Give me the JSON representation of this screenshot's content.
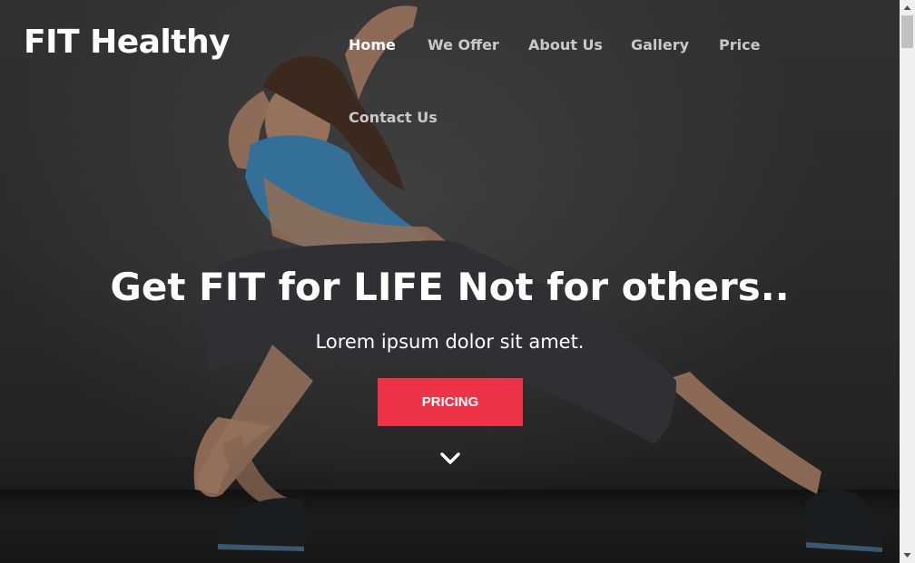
{
  "brand": {
    "logo": "FIT Healthy"
  },
  "nav": {
    "items": [
      {
        "label": "Home",
        "active": true
      },
      {
        "label": "We Offer"
      },
      {
        "label": "About Us"
      },
      {
        "label": "Gallery"
      },
      {
        "label": "Price"
      },
      {
        "label": "Contact Us"
      }
    ]
  },
  "hero": {
    "headline": "Get FIT for LIFE Not for others..",
    "subtitle": "Lorem ipsum dolor sit amet.",
    "cta_label": "PRICING",
    "scroll_icon": "chevron-down-icon"
  },
  "colors": {
    "accent": "#ee3349",
    "text": "#ffffff",
    "nav_inactive": "#c9c9c9"
  }
}
